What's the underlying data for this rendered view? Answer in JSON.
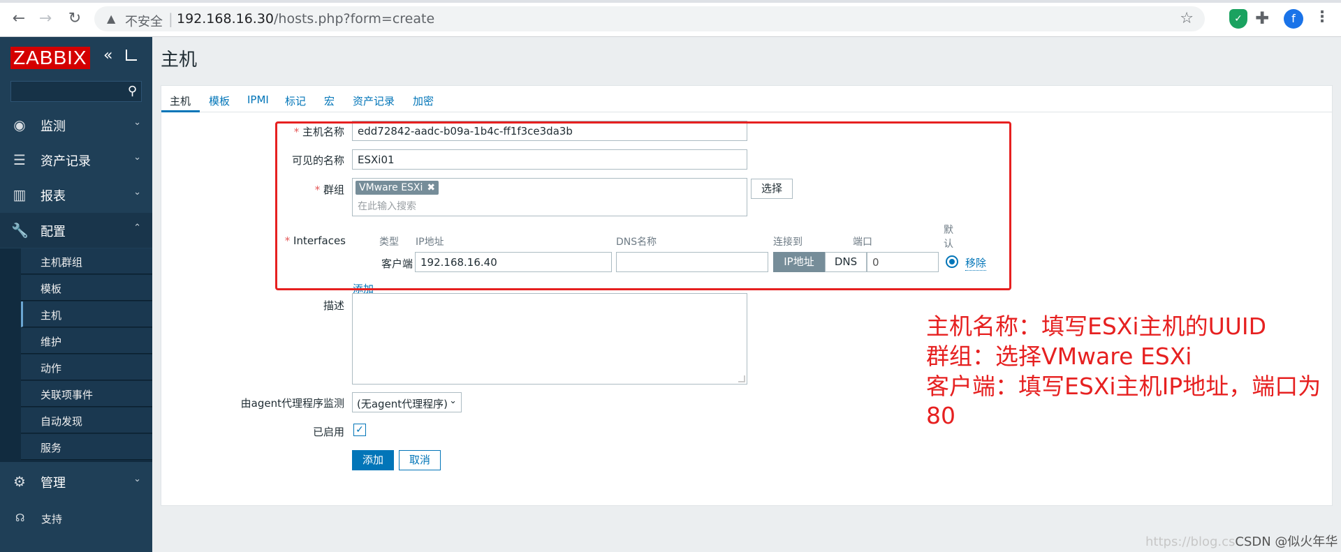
{
  "browser": {
    "security_label": "不安全",
    "url_host": "192.168.16.30",
    "url_path": "/hosts.php?form=create",
    "profile_initial": "f"
  },
  "sidebar": {
    "logo": "ZABBIX",
    "search_placeholder": "",
    "menu": [
      {
        "label": "监测",
        "icon": "eye-icon"
      },
      {
        "label": "资产记录",
        "icon": "list-icon"
      },
      {
        "label": "报表",
        "icon": "bar-chart-icon"
      },
      {
        "label": "配置",
        "icon": "wrench-icon"
      },
      {
        "label": "管理",
        "icon": "gear-icon"
      }
    ],
    "config_submenu": [
      "主机群组",
      "模板",
      "主机",
      "维护",
      "动作",
      "关联项事件",
      "自动发现",
      "服务"
    ],
    "support": "支持"
  },
  "page": {
    "title": "主机",
    "tabs": [
      "主机",
      "模板",
      "IPMI",
      "标记",
      "宏",
      "资产记录",
      "加密"
    ]
  },
  "form": {
    "host_name_label": "主机名称",
    "host_name_value": "edd72842-aadc-b09a-1b4c-ff1f3ce3da3b",
    "visible_name_label": "可见的名称",
    "visible_name_value": "ESXi01",
    "groups_label": "群组",
    "group_chip": "VMware ESXi",
    "groups_placeholder": "在此输入搜索",
    "select_button": "选择",
    "interfaces_label": "Interfaces",
    "iface_headers": {
      "type": "类型",
      "ip": "IP地址",
      "dns": "DNS名称",
      "connect": "连接到",
      "port": "端口",
      "default_1": "默",
      "default_2": "认"
    },
    "iface_row": {
      "type": "客户端",
      "ip": "192.168.16.40",
      "dns": "",
      "connect_ip": "IP地址",
      "connect_dns": "DNS",
      "port": "0",
      "remove": "移除"
    },
    "add_interface": "添加",
    "description_label": "描述",
    "proxy_label": "由agent代理程序监测",
    "proxy_value": "(无agent代理程序)",
    "enabled_label": "已启用",
    "add_button": "添加",
    "cancel_button": "取消"
  },
  "annotation": {
    "line1": "主机名称：填写ESXi主机的UUID",
    "line2": "群组：选择VMware ESXi",
    "line3": "客户端：填写ESXi主机IP地址，端口为80"
  },
  "watermark": {
    "faint": "https://blog.cs",
    "text": "CSDN @似火年华NG"
  },
  "colors": {
    "accent": "#0275b8",
    "sidebar": "#1f3f57",
    "annotation": "#e62020",
    "logo": "#d40000"
  }
}
